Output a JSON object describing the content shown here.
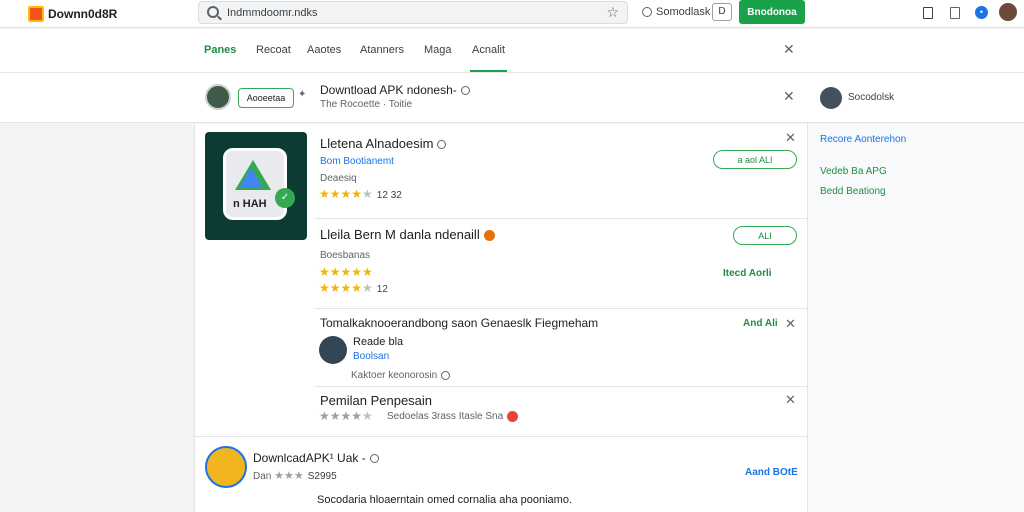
{
  "topbar": {
    "logo_text": "Downn0d8R",
    "search_value": "Indmmdoomr.ndks",
    "status_text": "Somodlask",
    "ext_label": "D",
    "download_label": "Bnodonoa"
  },
  "tabs": [
    {
      "label": "Panes"
    },
    {
      "label": "Recoat"
    },
    {
      "label": "Aaotes"
    },
    {
      "label": "Atanners"
    },
    {
      "label": "Maga"
    },
    {
      "label": "Acnalit"
    }
  ],
  "context": {
    "pill_label": "Aooeetaa",
    "title": "Downtload APK ndonesh-",
    "subtitle": "The Rocoette · Toitie"
  },
  "right_panel": {
    "user_label": "Socodolsk",
    "links": [
      {
        "label": "Recore Aonterehon",
        "color": "#1a73e8"
      },
      {
        "label": "Vedeb Ba APG",
        "color": "#1e8e3e"
      },
      {
        "label": "Bedd Beationg",
        "color": "#1e8e3e"
      }
    ]
  },
  "results": [
    {
      "title": "Lletena Alnadoesim",
      "publisher": "Bom Bootianemt",
      "category": "Deaesiq",
      "rating": 4,
      "rating_text": "12 32",
      "action": "a aol ALI"
    },
    {
      "title": "Lleila Bern M danla ndenaill",
      "category": "Boesbanas",
      "rating": 5,
      "rating2": 4,
      "rating_text": "12",
      "action": "ALI",
      "action_secondary": "Itecd Aorli"
    },
    {
      "title": "Tomalkaknooerandbong saon Genaeslk Fiegmeham",
      "person_name": "Reade bla",
      "person_link": "Boolsan",
      "note": "Kaktoer keonorosin",
      "action": "And Ali"
    },
    {
      "title": "Pemilan Penpesain",
      "rating": 4,
      "meta": "Sedoelas 3rass Itasle Sna"
    }
  ],
  "bottom_result": {
    "title": "DownlcadAPK¹ Uak -",
    "rating": 3,
    "sub_text": "Dan",
    "count": "S2995",
    "action": "Aand BOtE",
    "description": "Socodaria hloaerntain omed cornalia aha pooniamo."
  }
}
